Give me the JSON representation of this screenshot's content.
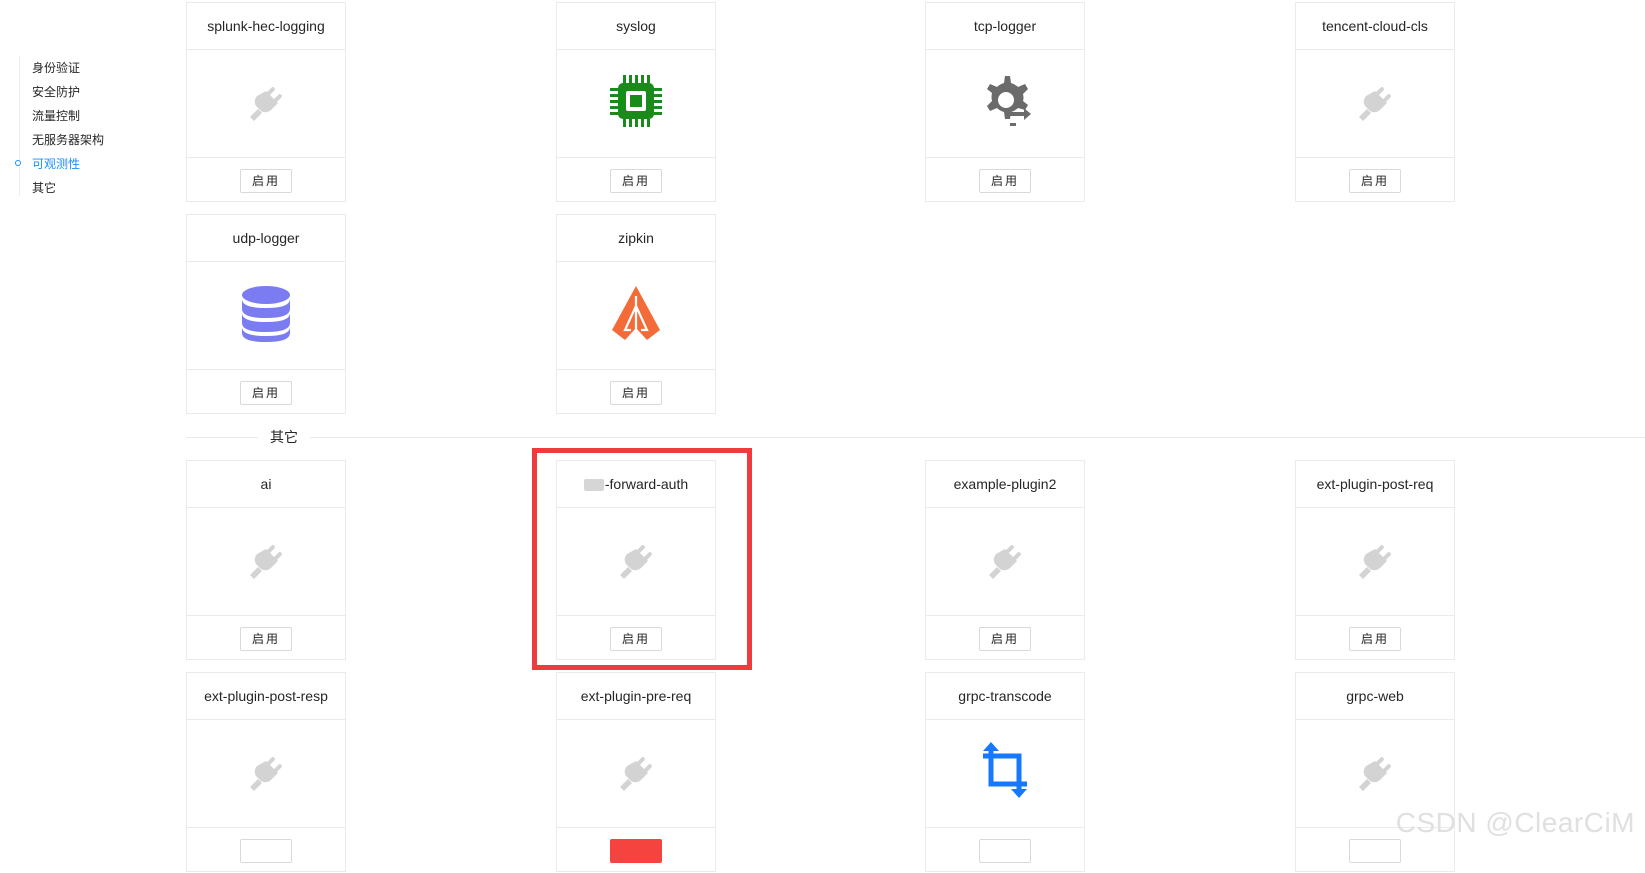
{
  "sidebar": {
    "items": [
      {
        "label": "身份验证",
        "active": false
      },
      {
        "label": "安全防护",
        "active": false
      },
      {
        "label": "流量控制",
        "active": false
      },
      {
        "label": "无服务器架构",
        "active": false
      },
      {
        "label": "可观测性",
        "active": true
      },
      {
        "label": "其它",
        "active": false
      }
    ]
  },
  "observability": {
    "plugins": [
      {
        "name": "splunk-hec-logging",
        "icon": "plug-icon",
        "button": "启用"
      },
      {
        "name": "syslog",
        "icon": "chip-icon",
        "button": "启用"
      },
      {
        "name": "tcp-logger",
        "icon": "gear-exchange-icon",
        "button": "启用"
      },
      {
        "name": "tencent-cloud-cls",
        "icon": "plug-icon",
        "button": "启用"
      },
      {
        "name": "udp-logger",
        "icon": "database-icon",
        "button": "启用"
      },
      {
        "name": "zipkin",
        "icon": "zipkin-icon",
        "button": "启用"
      }
    ]
  },
  "other": {
    "section_title": "其它",
    "plugins": [
      {
        "name": "ai",
        "icon": "plug-icon",
        "button": "启用"
      },
      {
        "name": "-forward-auth",
        "icon": "plug-icon",
        "button": "启用"
      },
      {
        "name": "example-plugin2",
        "icon": "plug-icon",
        "button": "启用"
      },
      {
        "name": "ext-plugin-post-req",
        "icon": "plug-icon",
        "button": "启用"
      },
      {
        "name": "ext-plugin-post-resp",
        "icon": "plug-icon",
        "button": ""
      },
      {
        "name": "ext-plugin-pre-req",
        "icon": "plug-icon",
        "button": ""
      },
      {
        "name": "grpc-transcode",
        "icon": "crop-icon",
        "button": ""
      },
      {
        "name": "grpc-web",
        "icon": "plug-icon",
        "button": ""
      }
    ]
  },
  "colors": {
    "accent": "#1890ff",
    "highlight": "#ee3c3c",
    "syslog_green": "#1a8a1a",
    "database_purple": "#7b7cf2",
    "zipkin_orange": "#f46b3a",
    "crop_blue": "#1677ff"
  },
  "watermark": "CSDN @ClearCiM"
}
